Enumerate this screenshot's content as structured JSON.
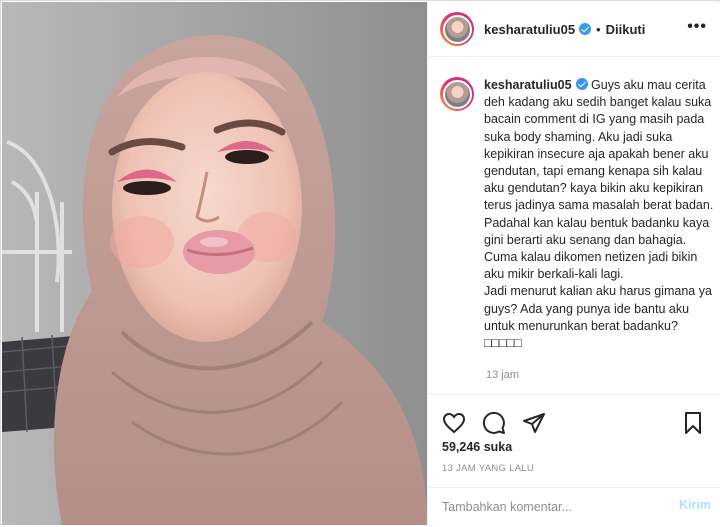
{
  "colors": {
    "accent": "#3897f0",
    "post_disabled": "#b2dffc",
    "muted": "#8e8e8e",
    "border": "#efefef"
  },
  "header": {
    "username": "kesharatuliu05",
    "verified": true,
    "separator": "•",
    "follow_status": "Diikuti",
    "more": "•••"
  },
  "caption": {
    "username": "kesharatuliu05",
    "text": "Guys aku mau cerita deh kadang aku sedih banget kalau suka bacain comment di IG yang masih pada suka body shaming. Aku jadi suka kepikiran insecure aja apakah bener aku gendutan, tapi emang kenapa sih kalau aku gendutan? kaya bikin aku kepikiran terus jadinya sama masalah berat badan. Padahal kan kalau bentuk badanku kaya gini berarti aku senang dan bahagia. Cuma kalau dikomen netizen jadi bikin aku mikir berkali-kali lagi.\nJadi menurut kalian aku harus gimana ya guys? Ada yang punya ide bantu aku untuk menurunkan berat badanku?□□□□□",
    "time": "13 jam"
  },
  "actions": {
    "icons": [
      "heart-icon",
      "comment-icon",
      "share-icon",
      "bookmark-icon"
    ],
    "likes": "59,246 suka",
    "posted_ago": "13 JAM YANG LALU"
  },
  "comment": {
    "placeholder": "Tambahkan komentar...",
    "value": "",
    "post_label": "Kirim"
  }
}
